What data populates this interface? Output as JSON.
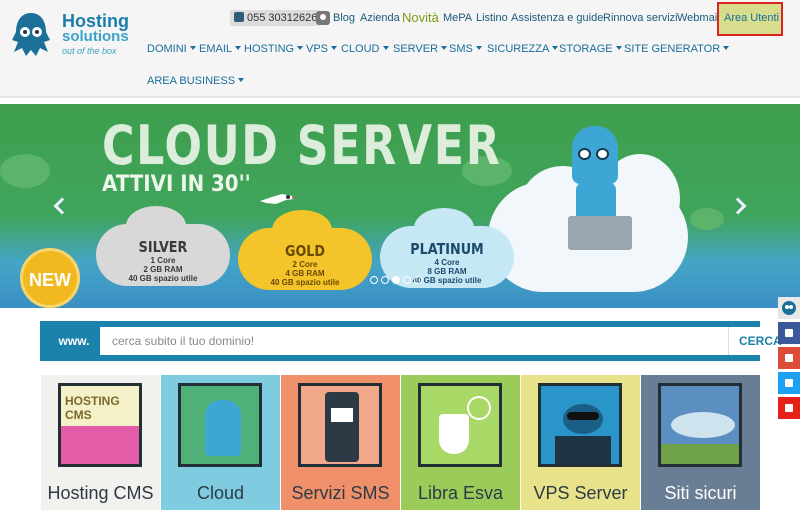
{
  "header": {
    "logo": {
      "line1": "Hosting",
      "line2": "solutions",
      "tagline": "out of the box"
    },
    "toplinks": {
      "phone": "055 30312626",
      "blog": "Blog",
      "azienda": "Azienda",
      "novita": "Novità",
      "mepa": "MePA",
      "listino": "Listino",
      "assistenza": "Assistenza e guide",
      "rinnova": "Rinnova servizi",
      "webmail": "Webmail",
      "area_utenti": "Area Utenti"
    },
    "nav": [
      "DOMINI",
      "EMAIL",
      "HOSTING",
      "VPS",
      "CLOUD",
      "SERVER",
      "SMS",
      "SICUREZZA",
      "STORAGE",
      "SITE GENERATOR",
      "AREA BUSINESS"
    ]
  },
  "banner": {
    "title": "CLOUD SERVER",
    "subtitle": "ATTIVI IN 30''",
    "badge": "NEW",
    "plans": [
      {
        "name": "SILVER",
        "core": "1 Core",
        "ram": "2 GB RAM",
        "space": "40 GB spazio utile"
      },
      {
        "name": "GOLD",
        "core": "2 Core",
        "ram": "4 GB RAM",
        "space": "40 GB spazio utile"
      },
      {
        "name": "PLATINUM",
        "core": "4 Core",
        "ram": "8 GB RAM",
        "space": "40 GB spazio utile"
      }
    ],
    "slides_total": 5,
    "active_slide": 3
  },
  "search": {
    "prefix": "www.",
    "placeholder": "cerca subito il tuo dominio!",
    "button": "CERCA"
  },
  "tiles": [
    {
      "label": "Hosting CMS",
      "inner_text": "HOSTING CMS",
      "bg": "#f1f1ee"
    },
    {
      "label": "Cloud",
      "bg": "#7fcbe0"
    },
    {
      "label": "Servizi SMS",
      "bg": "#f0906a"
    },
    {
      "label": "Libra Esva",
      "bg": "#9bcc5a"
    },
    {
      "label": "VPS Server",
      "bg": "#e8e38a"
    },
    {
      "label": "Siti sicuri",
      "bg": "#697d95"
    }
  ],
  "social": [
    {
      "icon": "mascot-icon",
      "color": "#e8e8e8"
    },
    {
      "icon": "facebook-icon",
      "color": "#3b5998"
    },
    {
      "icon": "google-plus-icon",
      "color": "#dd4b39"
    },
    {
      "icon": "twitter-icon",
      "color": "#1da1f2"
    },
    {
      "icon": "youtube-icon",
      "color": "#e62117"
    }
  ]
}
